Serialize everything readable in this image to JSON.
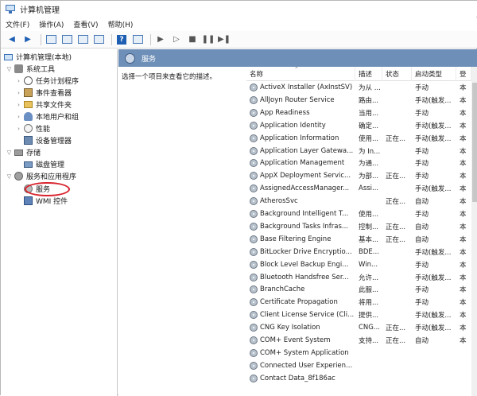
{
  "window": {
    "title": "计算机管理"
  },
  "menu": [
    {
      "label": "文件(F)"
    },
    {
      "label": "操作(A)"
    },
    {
      "label": "查看(V)"
    },
    {
      "label": "帮助(H)"
    }
  ],
  "tree": {
    "root": "计算机管理(本地)",
    "system_tools": "系统工具",
    "task_scheduler": "任务计划程序",
    "event_viewer": "事件查看器",
    "shared_folders": "共享文件夹",
    "local_users": "本地用户和组",
    "performance": "性能",
    "device_manager": "设备管理器",
    "storage": "存储",
    "disk_management": "磁盘管理",
    "services_apps": "服务和应用程序",
    "services": "服务",
    "wmi": "WMI 控件"
  },
  "main": {
    "header": "服务",
    "description": "选择一个项目来查看它的描述。"
  },
  "list": {
    "columns": [
      "名称",
      "描述",
      "状态",
      "启动类型",
      "登"
    ],
    "rows": [
      [
        "ActiveX Installer (AxInstSV)",
        "为从 ...",
        "",
        "手动",
        "本"
      ],
      [
        "AllJoyn Router Service",
        "路由...",
        "",
        "手动(触发...",
        "本"
      ],
      [
        "App Readiness",
        "当用...",
        "",
        "手动",
        "本"
      ],
      [
        "Application Identity",
        "确定...",
        "",
        "手动(触发...",
        "本"
      ],
      [
        "Application Information",
        "使用...",
        "正在...",
        "手动(触发...",
        "本"
      ],
      [
        "Application Layer Gatewa...",
        "为 In...",
        "",
        "手动",
        "本"
      ],
      [
        "Application Management",
        "为通...",
        "",
        "手动",
        "本"
      ],
      [
        "AppX Deployment Servic...",
        "为部...",
        "正在...",
        "手动",
        "本"
      ],
      [
        "AssignedAccessManager...",
        "Assi...",
        "",
        "手动(触发...",
        "本"
      ],
      [
        "AtherosSvc",
        "",
        "正在...",
        "自动",
        "本"
      ],
      [
        "Background Intelligent T...",
        "使用...",
        "",
        "手动",
        "本"
      ],
      [
        "Background Tasks Infras...",
        "控制...",
        "正在...",
        "自动",
        "本"
      ],
      [
        "Base Filtering Engine",
        "基本...",
        "正在...",
        "自动",
        "本"
      ],
      [
        "BitLocker Drive Encryptio...",
        "BDE...",
        "",
        "手动(触发...",
        "本"
      ],
      [
        "Block Level Backup Engi...",
        "Win...",
        "",
        "手动",
        "本"
      ],
      [
        "Bluetooth Handsfree Ser...",
        "允许...",
        "",
        "手动(触发...",
        "本"
      ],
      [
        "BranchCache",
        "此服...",
        "",
        "手动",
        "本"
      ],
      [
        "Certificate Propagation",
        "将用...",
        "",
        "手动",
        "本"
      ],
      [
        "Client License Service (Cli...",
        "提供...",
        "",
        "手动(触发...",
        "本"
      ],
      [
        "CNG Key Isolation",
        "CNG...",
        "正在...",
        "手动(触发...",
        "本"
      ],
      [
        "COM+ Event System",
        "支持...",
        "正在...",
        "自动",
        "本"
      ],
      [
        "COM+ System Application",
        "",
        "",
        "",
        ""
      ],
      [
        "Connected User Experien...",
        "",
        "",
        "",
        ""
      ],
      [
        "Contact Data_8f186ac",
        "",
        "",
        "",
        ""
      ]
    ]
  }
}
